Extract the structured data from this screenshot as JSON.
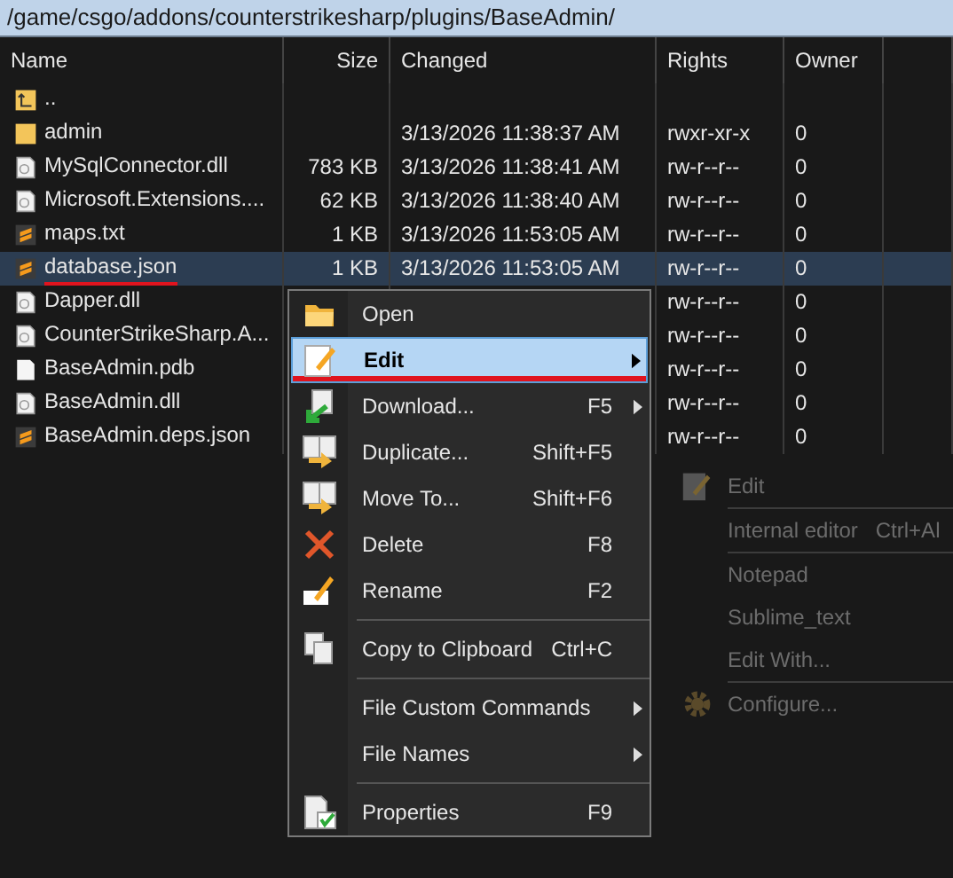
{
  "path": "/game/csgo/addons/counterstrikesharp/plugins/BaseAdmin/",
  "columns": [
    "Name",
    "Size",
    "Changed",
    "Rights",
    "Owner"
  ],
  "files": [
    {
      "kind": "parent",
      "name": "..",
      "selected": false,
      "underlined": false
    },
    {
      "kind": "folder",
      "name": "admin",
      "changed": "3/13/2026 11:38:37 AM",
      "rights": "rwxr-xr-x",
      "owner": "0",
      "selected": false,
      "underlined": false
    },
    {
      "kind": "dll",
      "name": "MySqlConnector.dll",
      "size": "783 KB",
      "changed": "3/13/2026 11:38:41 AM",
      "rights": "rw-r--r--",
      "owner": "0",
      "selected": false,
      "underlined": false
    },
    {
      "kind": "dll",
      "name": "Microsoft.Extensions....",
      "size": "62 KB",
      "changed": "3/13/2026 11:38:40 AM",
      "rights": "rw-r--r--",
      "owner": "0",
      "selected": false,
      "underlined": false
    },
    {
      "kind": "sublime",
      "name": "maps.txt",
      "size": "1 KB",
      "changed": "3/13/2026 11:53:05 AM",
      "rights": "rw-r--r--",
      "owner": "0",
      "selected": false,
      "underlined": false
    },
    {
      "kind": "sublime",
      "name": "database.json",
      "size": "1 KB",
      "changed": "3/13/2026 11:53:05 AM",
      "rights": "rw-r--r--",
      "owner": "0",
      "selected": true,
      "underlined": true
    },
    {
      "kind": "dll",
      "name": "Dapper.dll",
      "rights": "rw-r--r--",
      "owner": "0",
      "selected": false,
      "underlined": false
    },
    {
      "kind": "dll",
      "name": "CounterStrikeSharp.A...",
      "rights": "rw-r--r--",
      "owner": "0",
      "selected": false,
      "underlined": false
    },
    {
      "kind": "blank",
      "name": "BaseAdmin.pdb",
      "rights": "rw-r--r--",
      "owner": "0",
      "selected": false,
      "underlined": false
    },
    {
      "kind": "dll",
      "name": "BaseAdmin.dll",
      "rights": "rw-r--r--",
      "owner": "0",
      "selected": false,
      "underlined": false
    },
    {
      "kind": "sublime",
      "name": "BaseAdmin.deps.json",
      "rights": "rw-r--r--",
      "owner": "0",
      "selected": false,
      "underlined": false
    }
  ],
  "context_menu": [
    {
      "kind": "open",
      "label": "Open",
      "submenu": false,
      "selected": false,
      "underlined": false
    },
    {
      "kind": "edit",
      "label": "Edit",
      "submenu": true,
      "selected": true,
      "underlined": true
    },
    {
      "kind": "download",
      "label": "Download...",
      "shortcut": "F5",
      "submenu": true,
      "selected": false,
      "underlined": false
    },
    {
      "kind": "duplicate",
      "label": "Duplicate...",
      "shortcut": "Shift+F5",
      "submenu": false,
      "selected": false,
      "underlined": false
    },
    {
      "kind": "move",
      "label": "Move To...",
      "shortcut": "Shift+F6",
      "submenu": false,
      "selected": false,
      "underlined": false
    },
    {
      "kind": "delete",
      "label": "Delete",
      "shortcut": "F8",
      "submenu": false,
      "selected": false,
      "underlined": false
    },
    {
      "kind": "rename",
      "label": "Rename",
      "shortcut": "F2",
      "submenu": false,
      "selected": false,
      "underlined": false
    },
    {
      "kind": "separator"
    },
    {
      "kind": "copy",
      "label": "Copy to Clipboard",
      "shortcut": "Ctrl+C",
      "submenu": false,
      "selected": false,
      "underlined": false
    },
    {
      "kind": "separator"
    },
    {
      "kind": "plain",
      "label": "File Custom Commands",
      "submenu": true,
      "selected": false,
      "underlined": false
    },
    {
      "kind": "plain",
      "label": "File Names",
      "submenu": true,
      "selected": false,
      "underlined": false
    },
    {
      "kind": "separator"
    },
    {
      "kind": "properties",
      "label": "Properties",
      "shortcut": "F9",
      "submenu": false,
      "selected": false,
      "underlined": false
    }
  ],
  "fading_submenu": [
    {
      "kind": "edit",
      "label": "Edit"
    },
    {
      "kind": "separator"
    },
    {
      "kind": "plain",
      "label": "Internal editor",
      "shortcut": "Ctrl+Al"
    },
    {
      "kind": "separator"
    },
    {
      "kind": "plain",
      "label": "Notepad"
    },
    {
      "kind": "plain",
      "label": "Sublime_text"
    },
    {
      "kind": "plain",
      "label": "Edit With..."
    },
    {
      "kind": "separator"
    },
    {
      "kind": "gear",
      "label": "Configure..."
    }
  ]
}
